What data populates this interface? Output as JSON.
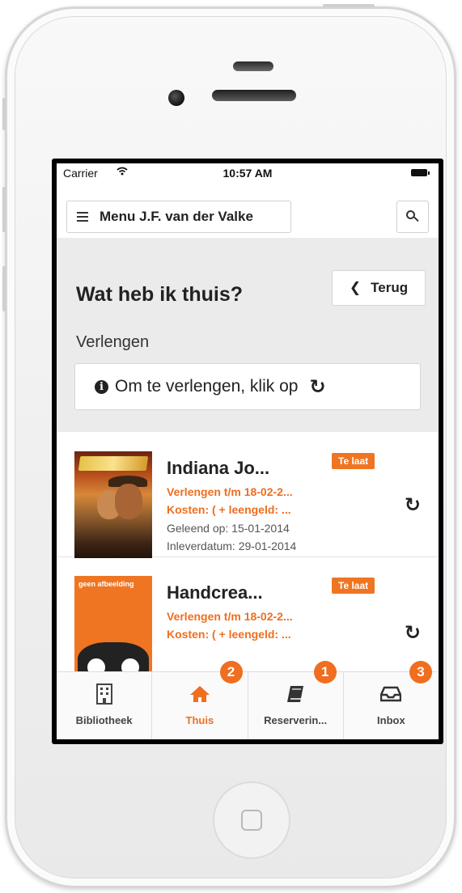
{
  "status_bar": {
    "carrier": "Carrier",
    "time": "10:57 AM"
  },
  "header": {
    "menu_label": "Menu J.F. van der Valke",
    "icons": {
      "menu": "hamburger-icon",
      "search": "search-icon"
    }
  },
  "page": {
    "title": "Wat heb ik thuis?",
    "back_label": "Terug",
    "section_title": "Verlengen",
    "info_text": "Om te verlengen, klik op"
  },
  "items": [
    {
      "title": "Indiana Jo...",
      "badge": "Te laat",
      "renew_line": "Verlengen t/m 18-02-2...",
      "cost_line": "Kosten: ( + leengeld: ...",
      "borrowed_line": "Geleend op: 15-01-2014",
      "return_line": "Inleverdatum: 29-01-2014",
      "cover": "movie-poster"
    },
    {
      "title": "Handcrea...",
      "badge": "Te laat",
      "renew_line": "Verlengen t/m 18-02-2...",
      "cost_line": "Kosten: ( + leengeld: ...",
      "cover_placeholder": "geen afbeelding"
    }
  ],
  "tabs": [
    {
      "label": "Bibliotheek",
      "icon": "building-icon",
      "badge": null,
      "active": false
    },
    {
      "label": "Thuis",
      "icon": "home-icon",
      "badge": "2",
      "active": true
    },
    {
      "label": "Reserverin...",
      "icon": "book-icon",
      "badge": "1",
      "active": false
    },
    {
      "label": "Inbox",
      "icon": "inbox-icon",
      "badge": "3",
      "active": false
    }
  ],
  "colors": {
    "accent": "#ef6e1f",
    "panel_bg": "#ebebeb",
    "text": "#222222"
  }
}
